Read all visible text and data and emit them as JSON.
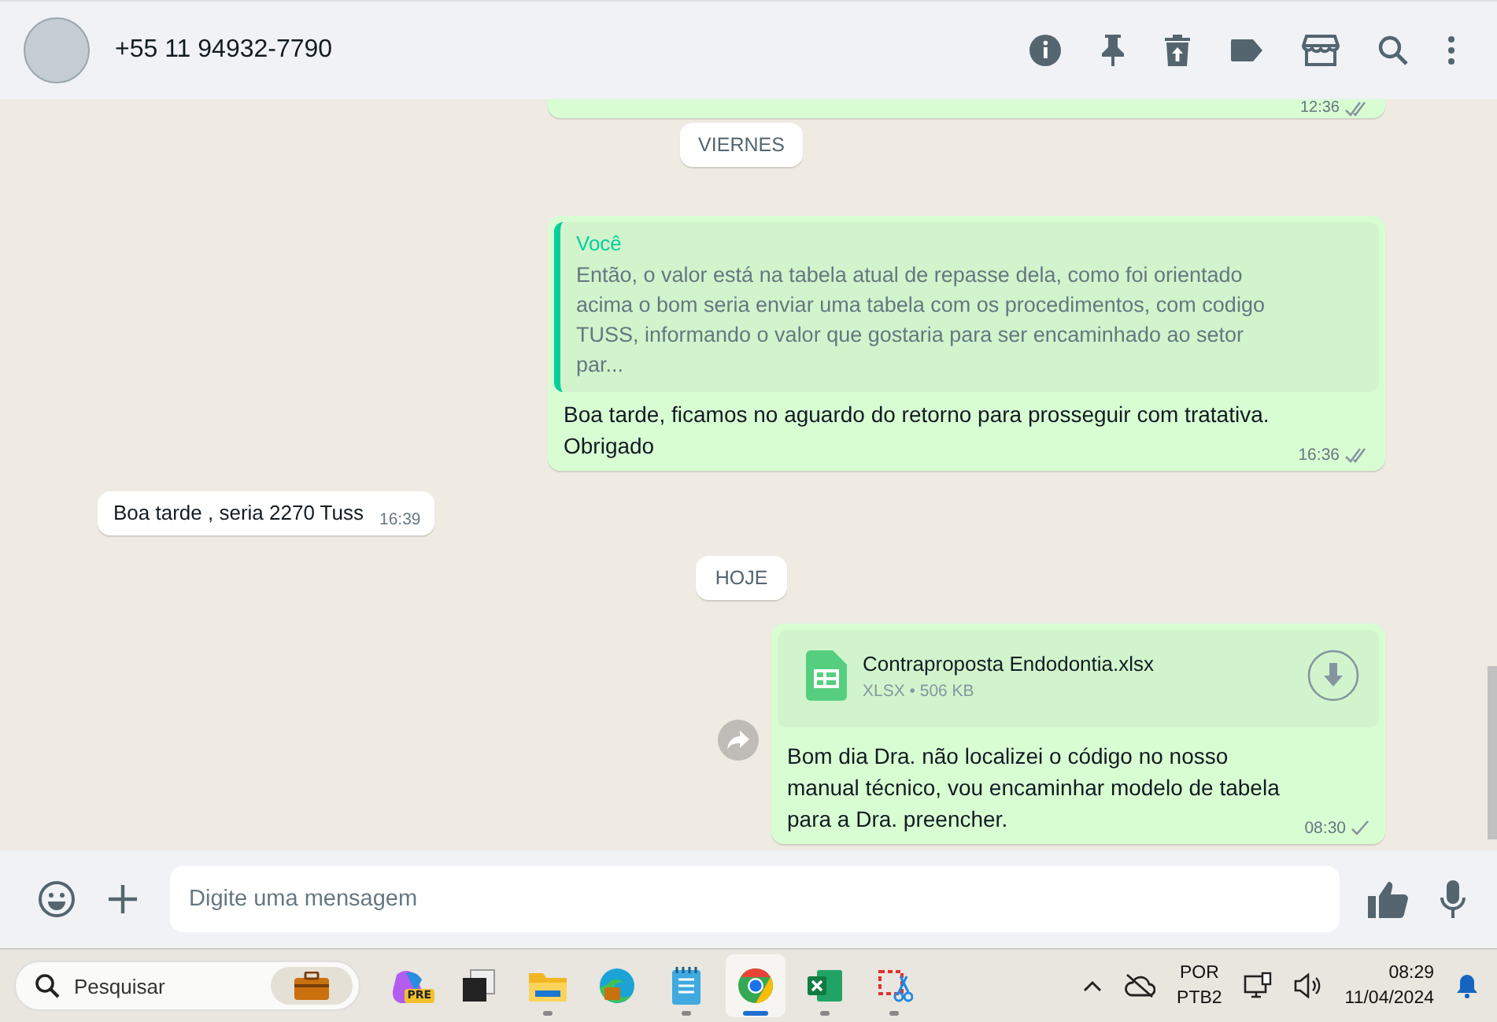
{
  "header": {
    "contact": "+55 11 94932-7790"
  },
  "chat": [
    {
      "kind": "cut",
      "time": "12:36",
      "double_check": true
    },
    {
      "kind": "date",
      "label": "VIERNES"
    },
    {
      "kind": "outgoing",
      "quote": {
        "author": "Você",
        "text": "Então, o valor está na tabela atual de repasse dela, como foi orientado acima o bom seria enviar uma tabela com os procedimentos, com codigo TUSS, informando o valor que gostaria para ser encaminhado ao setor par..."
      },
      "text": "Boa tarde, ficamos no aguardo do retorno para prosseguir com tratativa. Obrigado",
      "time": "16:36",
      "double_check": true
    },
    {
      "kind": "incoming",
      "text": "Boa tarde ,  seria 2270 Tuss",
      "time": "16:39"
    },
    {
      "kind": "date",
      "label": "HOJE"
    },
    {
      "kind": "outgoing",
      "file": {
        "name": "Contraproposta Endodontia.xlsx",
        "meta": "XLSX • 506 KB"
      },
      "text": "Bom dia Dra. não localizei o código no nosso manual técnico, vou encaminhar modelo de tabela para a Dra. preencher.",
      "time": "08:30",
      "double_check": false
    }
  ],
  "composer": {
    "placeholder": "Digite uma mensagem"
  },
  "taskbar": {
    "search": "Pesquisar",
    "apps": [
      {
        "kind": "copilot",
        "badge": "PRE",
        "running": false,
        "selected": false
      },
      {
        "kind": "tasks",
        "running": false,
        "selected": false
      },
      {
        "kind": "folder",
        "running": true,
        "selected": false
      },
      {
        "kind": "edge",
        "running": false,
        "selected": false
      },
      {
        "kind": "notepad",
        "running": true,
        "selected": false
      },
      {
        "kind": "chrome",
        "running": true,
        "selected": true
      },
      {
        "kind": "excel",
        "running": true,
        "selected": false
      },
      {
        "kind": "snip",
        "running": true,
        "selected": false
      }
    ],
    "language": "POR",
    "layout": "PTB2",
    "time": "08:29",
    "date": "11/04/2024"
  }
}
